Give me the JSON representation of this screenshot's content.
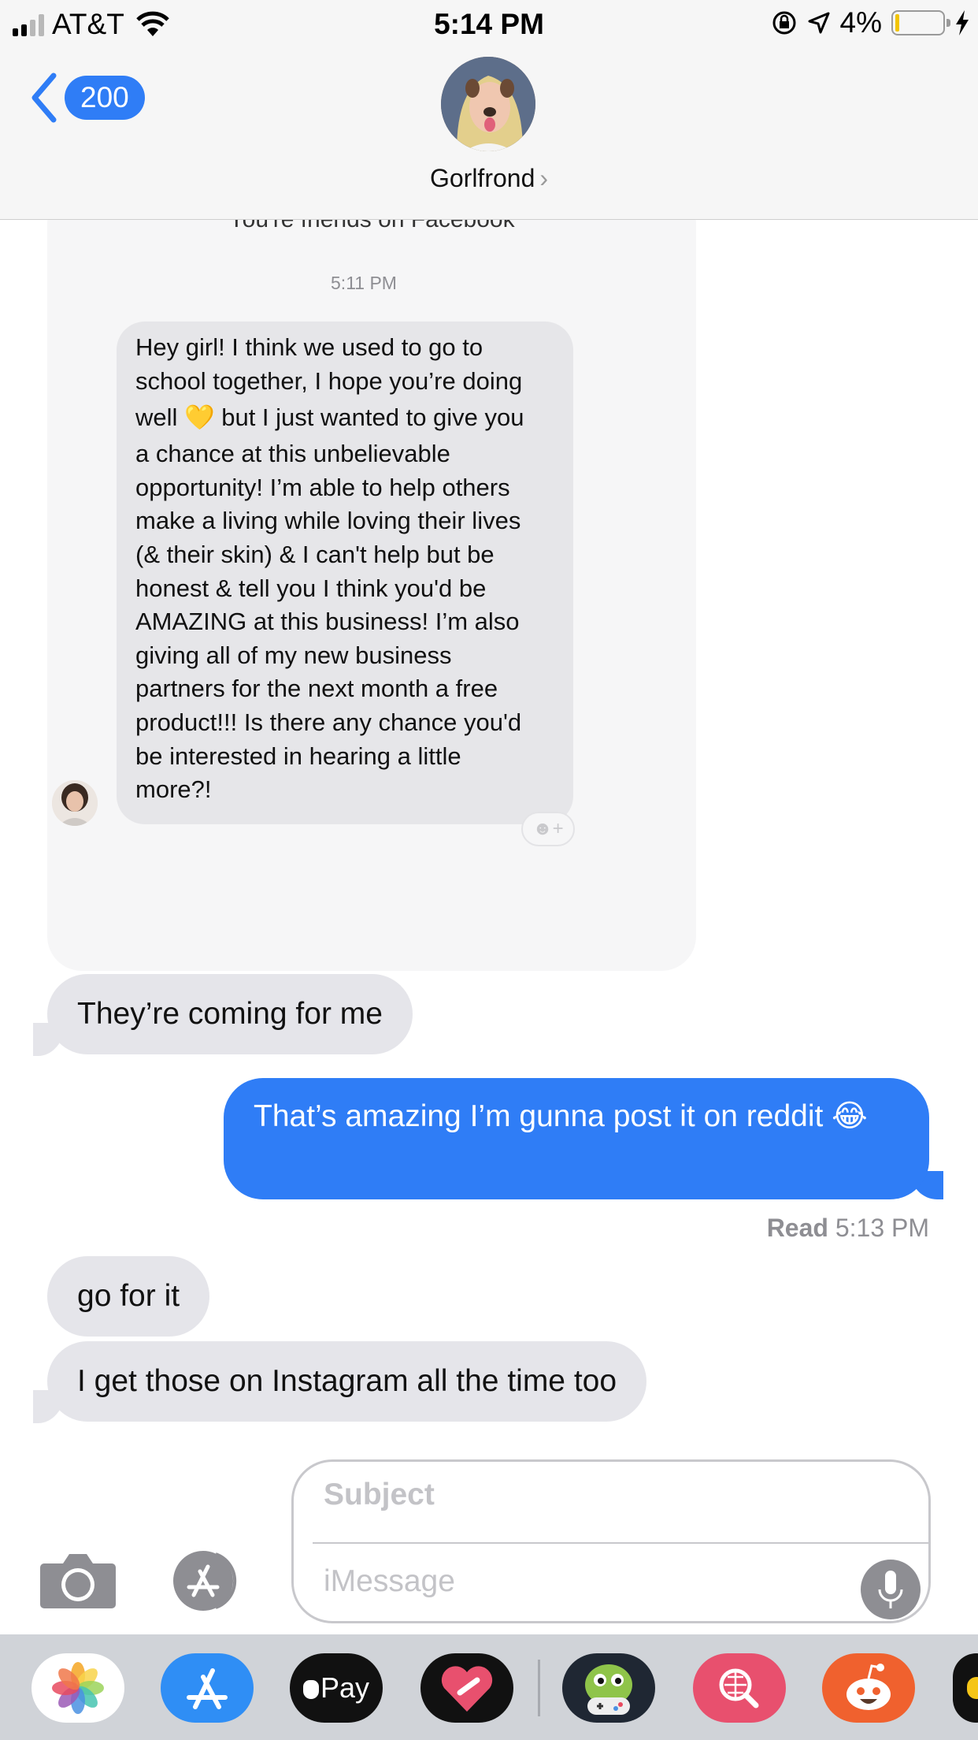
{
  "status_bar": {
    "carrier": "AT&T",
    "time": "5:14 PM",
    "battery_percent": "4%",
    "battery_level": 0.04
  },
  "header": {
    "back_count": "200",
    "contact_name": "Gorlfrond",
    "chevron": "›"
  },
  "forwarded_card": {
    "friends_text": "You're friends on Facebook",
    "timestamp": "5:11 PM",
    "message_lines": [
      "Hey girl! I think we used to go to",
      "school together, I hope you’re doing",
      "well 💛 but I just wanted to give you",
      "a chance at this unbelievable",
      "opportunity! I’m able to help others",
      "make a living while loving their lives",
      "(& their skin) & I can't help but be",
      "honest & tell you I think you'd be",
      "AMAZING at this business! I’m also",
      "giving all of my new business",
      "partners for the next month a free",
      "product!!! Is there any chance you'd",
      "be interested in hearing a little",
      "more?!"
    ],
    "reaction_icon": "☻+"
  },
  "messages": [
    {
      "direction": "incoming",
      "text": "They’re coming for me"
    },
    {
      "direction": "outgoing",
      "text": "That’s amazing I’m gunna post it on reddit 😂"
    },
    {
      "direction": "incoming",
      "text": "go for it"
    },
    {
      "direction": "incoming",
      "text": "I get those on Instagram all the time too"
    }
  ],
  "read_receipt": {
    "label": "Read",
    "time": "5:13 PM"
  },
  "compose": {
    "subject_placeholder": "Subject",
    "message_placeholder": "iMessage"
  },
  "app_drawer": {
    "apps": [
      "Photos",
      "App Store",
      "Apple Pay",
      "Digital Touch",
      "Game",
      "Web Search",
      "Reddit"
    ],
    "apple_pay_label": "Pay"
  },
  "colors": {
    "imessage_blue": "#2f7df6",
    "incoming_gray": "#e5e5ea",
    "header_bg": "#f6f6f6"
  }
}
